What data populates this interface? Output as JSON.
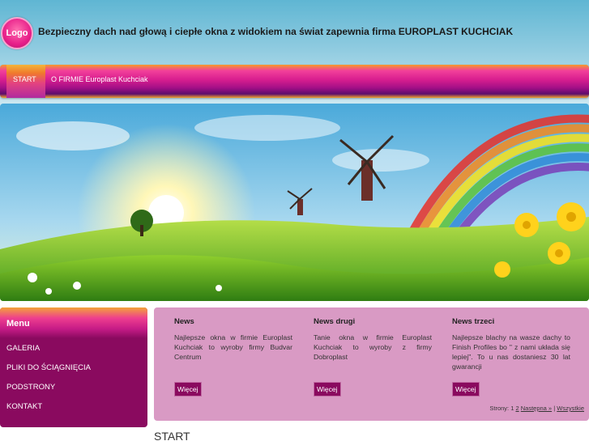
{
  "header": {
    "logo_text": "Logo",
    "slogan": "Bezpieczny dach nad głową i ciepłe okna z widokiem na świat zapewnia firma EUROPLAST KUCHCIAK"
  },
  "nav": {
    "items": [
      "START",
      "O FIRMIE Europlast Kuchciak"
    ]
  },
  "banner": {
    "description_icon": "rainbow-landscape-image"
  },
  "sidebar": {
    "title": "Menu",
    "links": [
      "GALERIA",
      "PLIKI DO ŚCIĄGNIĘCIA",
      "PODSTRONY",
      "KONTAKT"
    ]
  },
  "news": [
    {
      "title": "News",
      "text": "Najlepsze okna w firmie Europlast Kuchciak to wyroby firmy Budvar Centrum",
      "more": "Więcej"
    },
    {
      "title": "News drugi",
      "text": "Tanie okna w firmie Europlast Kuchciak to wyroby z firmy Dobroplast",
      "more": "Więcej"
    },
    {
      "title": "News trzeci",
      "text": "Najlepsze blachy na wasze dachy to Finish Profiles bo \" z nami układa się lepiej\". To u nas dostaniesz 30 lat gwarancji",
      "more": "Więcej"
    }
  ],
  "pager": {
    "label": "Strony: 1",
    "page2": "2",
    "next": "Następna »",
    "separator": "|",
    "all": "Wszystkie"
  },
  "content": {
    "heading": "START"
  },
  "colors": {
    "accent": "#8a0a5f",
    "news_bg": "#d99ac4",
    "sky": "#5fb6d3"
  }
}
